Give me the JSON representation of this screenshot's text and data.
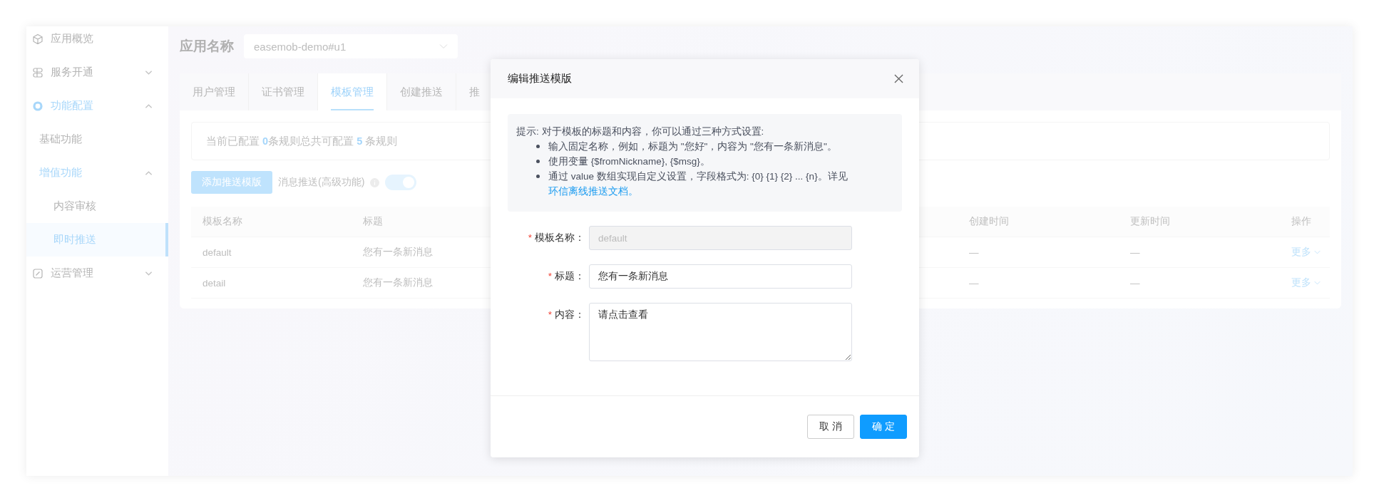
{
  "sidebar": {
    "items": [
      {
        "label": "应用概览",
        "active": false
      },
      {
        "label": "服务开通",
        "active": false,
        "expanded": false
      },
      {
        "label": "功能配置",
        "active": true,
        "expanded": true,
        "children": [
          {
            "label": "基础功能",
            "active": false
          },
          {
            "label": "增值功能",
            "active": true,
            "expanded": true,
            "children": [
              {
                "label": "内容审核",
                "selected": false
              },
              {
                "label": "即时推送",
                "selected": true
              }
            ]
          }
        ]
      },
      {
        "label": "运营管理",
        "active": false,
        "expanded": false
      }
    ]
  },
  "app_selector": {
    "label": "应用名称",
    "value": "easemob-demo#u1"
  },
  "tabs": [
    {
      "label": "用户管理",
      "selected": false
    },
    {
      "label": "证书管理",
      "selected": false
    },
    {
      "label": "模板管理",
      "selected": true
    },
    {
      "label": "创建推送",
      "selected": false
    },
    {
      "label": "推",
      "selected": false
    }
  ],
  "rule_info": {
    "prefix": "当前已配置 ",
    "configured": "0",
    "middle": "条规则总共可配置 ",
    "total": "5",
    "suffix": " 条规则"
  },
  "toolbar": {
    "add_button": "添加推送模版",
    "push_label": "消息推送(高级功能)",
    "push_enabled": true
  },
  "table": {
    "columns": [
      "模板名称",
      "标题",
      "创建时间",
      "更新时间",
      "操作"
    ],
    "rows": [
      {
        "cells": [
          "default",
          "您有一条新消息",
          "—",
          "—"
        ],
        "action": "更多"
      },
      {
        "cells": [
          "detail",
          "您有一条新消息",
          "—",
          "—"
        ],
        "action": "更多"
      }
    ]
  },
  "dialog": {
    "title": "编辑推送模版",
    "tip": {
      "intro": "提示: 对于模板的标题和内容，你可以通过三种方式设置:",
      "bullets": [
        {
          "text": "输入固定名称，例如，标题为 \"您好\"，内容为 \"您有一条新消息\"。"
        },
        {
          "text": "使用变量 {$fromNickname}, {$msg}。"
        },
        {
          "text": "通过 value 数组实现自定义设置，字段格式为: {0} {1} {2} ... {n}。详见",
          "link": "环信离线推送文档。"
        }
      ]
    },
    "fields": [
      {
        "label": "模板名称：",
        "required_mark": "*",
        "kind": "input",
        "value": "default",
        "disabled": true
      },
      {
        "label": "标题：",
        "required_mark": "*",
        "kind": "input",
        "value": "您有一条新消息",
        "disabled": false
      },
      {
        "label": "内容：",
        "required_mark": "*",
        "kind": "textarea",
        "value": "请点击查看",
        "disabled": false
      }
    ],
    "cancel": "取 消",
    "confirm": "确 定"
  }
}
